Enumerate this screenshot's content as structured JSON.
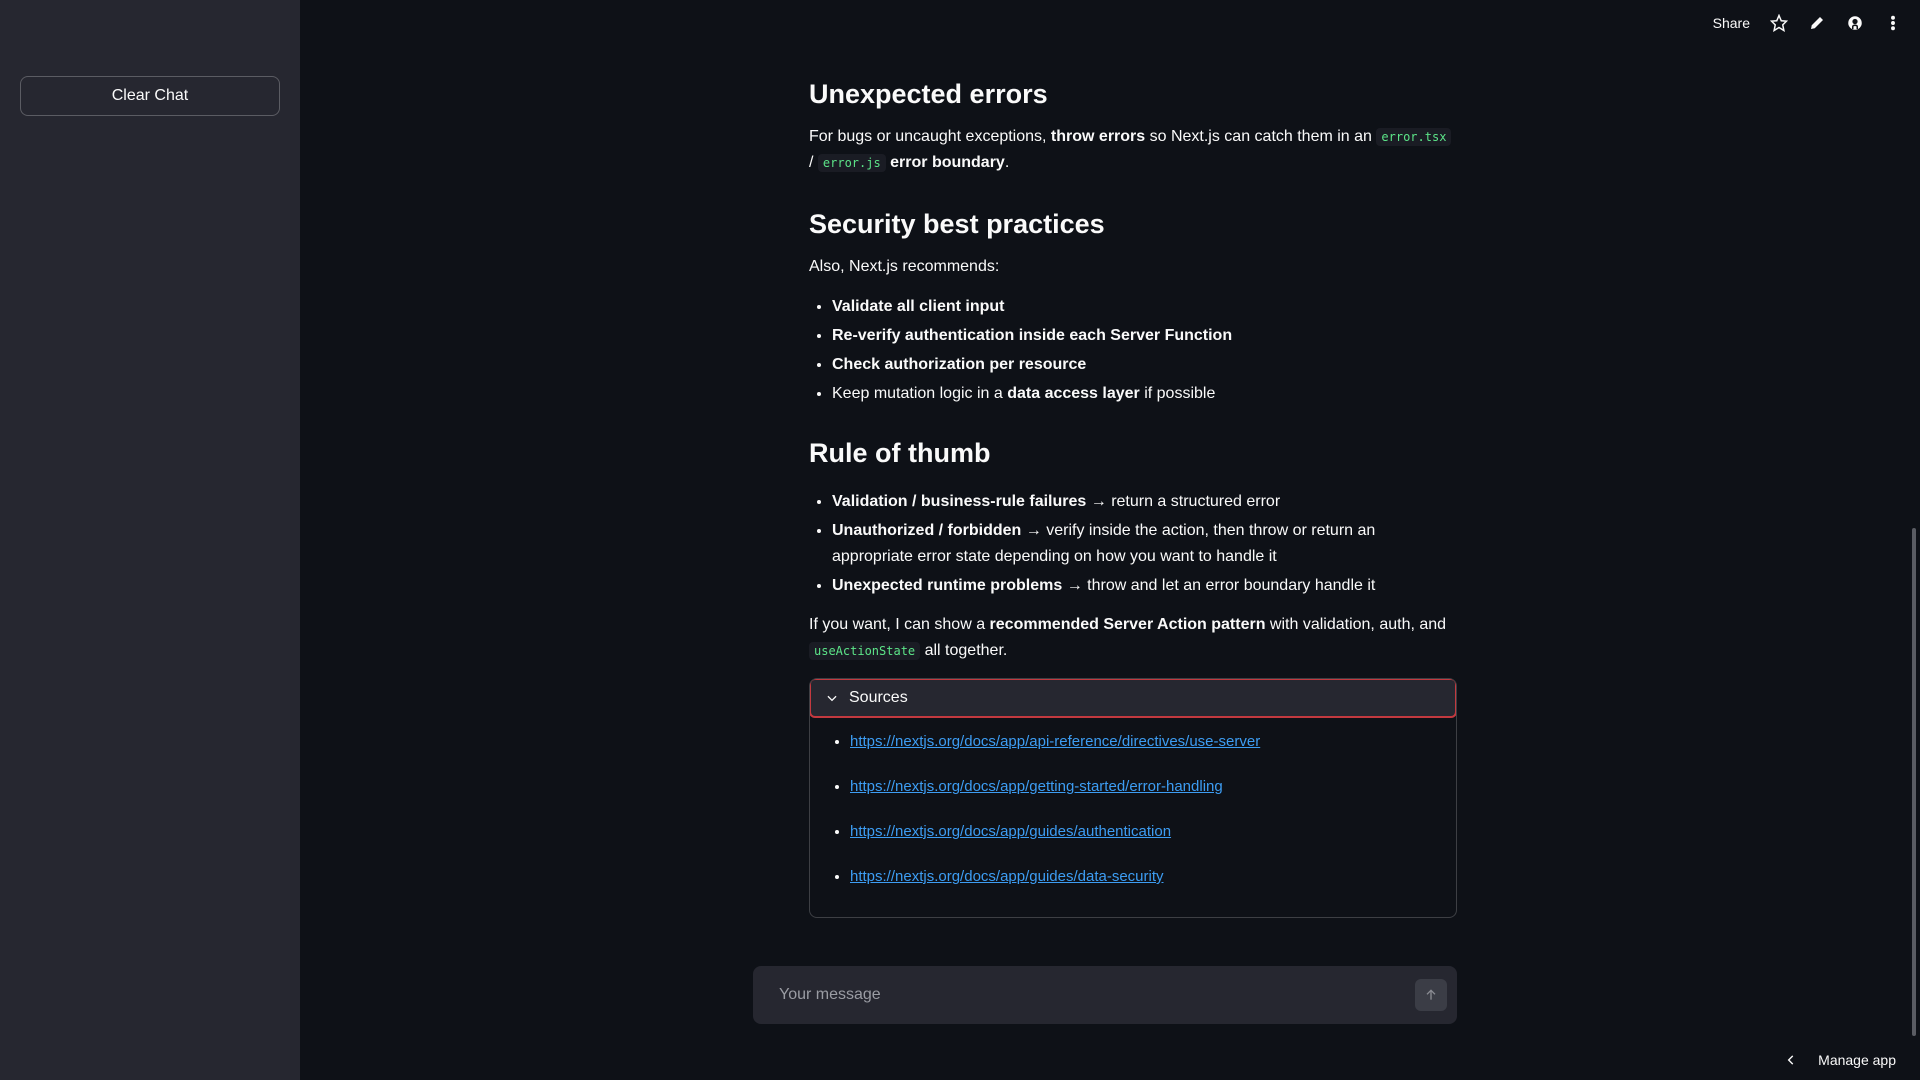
{
  "sidebar": {
    "clear_label": "Clear Chat"
  },
  "toolbar": {
    "share_label": "Share",
    "icons": [
      "star-icon",
      "pencil-icon",
      "github-icon",
      "more-vertical-icon"
    ]
  },
  "content": {
    "section1": {
      "title": "Unexpected errors",
      "p1_a": "For bugs or uncaught exceptions, ",
      "p1_b": "throw errors",
      "p1_c": " so Next.js can catch them in an ",
      "p1_code1": "error.tsx",
      "p1_d": " / ",
      "p1_code2": "error.js",
      "p1_e": " ",
      "p1_f": "error boundary",
      "p1_g": "."
    },
    "section2": {
      "title": "Security best practices",
      "intro": "Also, Next.js recommends:",
      "items": [
        {
          "bold": "Validate all client input"
        },
        {
          "bold": "Re-verify authentication inside each Server Function"
        },
        {
          "bold": "Check authorization per resource"
        },
        {
          "pre": "Keep mutation logic in a ",
          "bold": "data access layer",
          "post": " if possible"
        }
      ]
    },
    "section3": {
      "title": "Rule of thumb",
      "items": [
        {
          "bold": "Validation / business-rule failures",
          "post": " → return a structured error"
        },
        {
          "bold": "Unauthorized / forbidden",
          "post": " → verify inside the action, then throw or return an appropriate error state depending on how you want to handle it"
        },
        {
          "bold": "Unexpected runtime problems",
          "post": " → throw and let an error boundary handle it"
        }
      ]
    },
    "closing": {
      "a": "If you want, I can show a ",
      "b": "recommended Server Action pattern",
      "c": " with validation, auth, and ",
      "code": "useActionState",
      "d": " all together."
    }
  },
  "sources": {
    "label": "Sources",
    "links": [
      "https://nextjs.org/docs/app/api-reference/directives/use-server",
      "https://nextjs.org/docs/app/getting-started/error-handling",
      "https://nextjs.org/docs/app/guides/authentication",
      "https://nextjs.org/docs/app/guides/data-security"
    ]
  },
  "chat": {
    "placeholder": "Your message"
  },
  "footer": {
    "manage_label": "Manage app"
  },
  "colors": {
    "background": "#0e1117",
    "sidebar": "#262730",
    "accent_link": "#3d9df3",
    "code_text": "#5ce488",
    "highlight_border": "#c3393f"
  }
}
